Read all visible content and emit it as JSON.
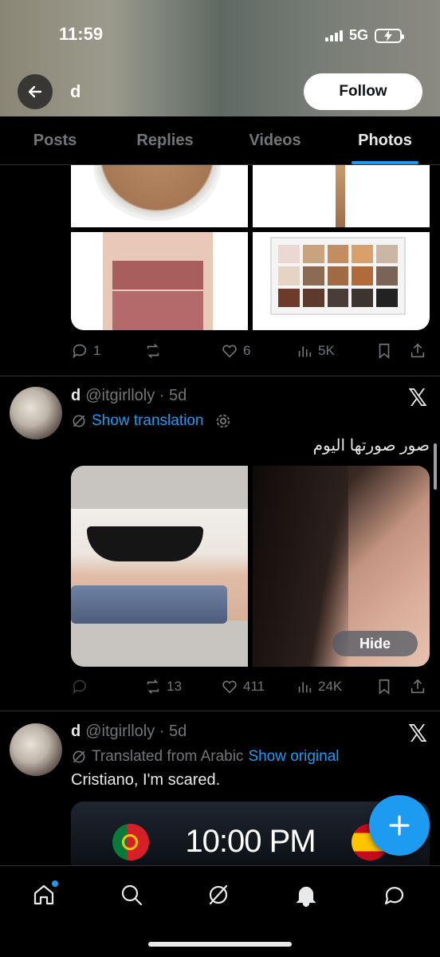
{
  "status_bar": {
    "time": "11:59",
    "network": "5G"
  },
  "header": {
    "title": "d",
    "follow_label": "Follow"
  },
  "tabs": [
    {
      "label": "Posts"
    },
    {
      "label": "Replies"
    },
    {
      "label": "Videos"
    },
    {
      "label": "Photos",
      "active": true
    }
  ],
  "post1": {
    "actions": {
      "replies": "1",
      "reposts": "",
      "likes": "6",
      "views": "5K"
    }
  },
  "post2": {
    "display_name": "d",
    "handle": "@itgirlloly",
    "age": "5d",
    "translation_label": "Show translation",
    "text": "صور صورتها اليوم",
    "hide_label": "Hide",
    "actions": {
      "replies": "",
      "reposts": "13",
      "likes": "411",
      "views": "24K"
    }
  },
  "post3": {
    "display_name": "d",
    "handle": "@itgirlloly",
    "age": "5d",
    "translated_from": "Translated from Arabic",
    "show_original": "Show original",
    "text": "Cristiano, I'm scared.",
    "clock_time": "10:00 PM"
  },
  "colors": {
    "accent": "#1d9bf0",
    "muted": "#71767b",
    "text": "#e7e9ea",
    "background": "#000000"
  },
  "icons": [
    "back-arrow-icon",
    "reply-icon",
    "repost-icon",
    "like-icon",
    "views-icon",
    "bookmark-icon",
    "share-icon",
    "translate-icon",
    "settings-icon",
    "x-logo-icon",
    "compose-icon",
    "home-icon",
    "search-icon",
    "grok-icon",
    "bell-icon",
    "messages-icon"
  ]
}
